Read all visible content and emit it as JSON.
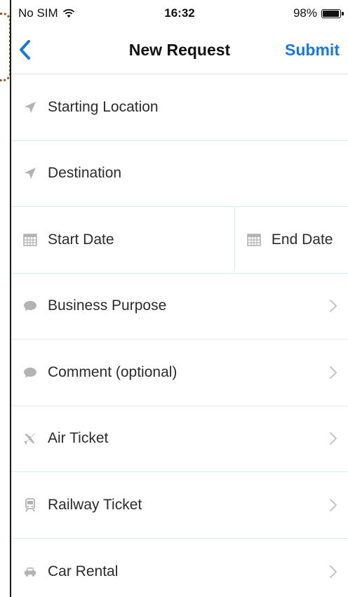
{
  "status_bar": {
    "carrier": "No SIM",
    "time": "16:32",
    "battery": "98%",
    "battery_level": 0.98
  },
  "nav": {
    "title": "New Request",
    "submit_label": "Submit",
    "back_icon": "chevron-left-icon"
  },
  "fields": {
    "starting_location": "Starting Location",
    "destination": "Destination",
    "start_date": "Start Date",
    "end_date": "End Date",
    "business_purpose": "Business Purpose",
    "comment": "Comment (optional)",
    "air_ticket": "Air Ticket",
    "railway_ticket": "Railway Ticket",
    "car_rental": "Car Rental"
  },
  "colors": {
    "accent": "#1a78d8",
    "icon_gray": "#b3b3b3",
    "separator": "#d8eef3"
  }
}
